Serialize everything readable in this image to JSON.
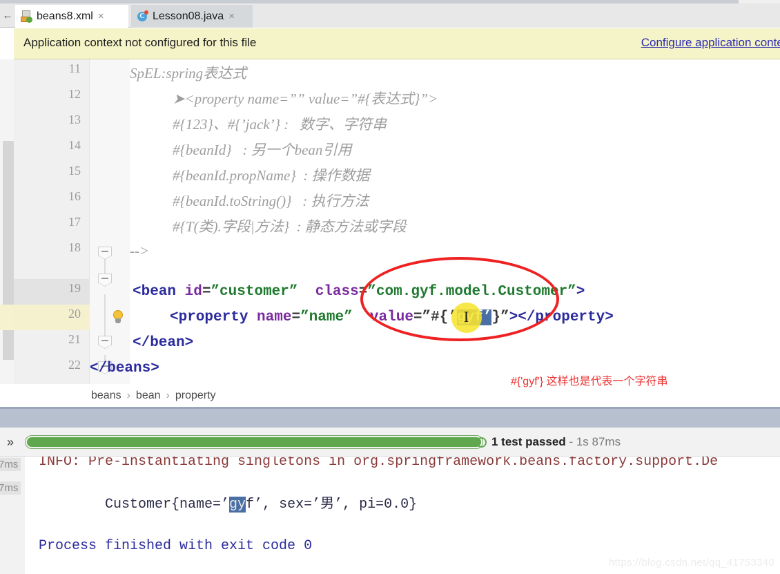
{
  "window": {
    "tabs": [
      {
        "label": "beans8.xml",
        "icon": "xml-file-icon",
        "active": true,
        "close": "×"
      },
      {
        "label": "Lesson08.java",
        "icon": "java-class-icon",
        "active": false,
        "close": "×"
      }
    ],
    "back_arrow": "←"
  },
  "banner": {
    "message": "Application context not configured for this file",
    "link": "Configure application context"
  },
  "editor": {
    "lines": [
      {
        "num": "11",
        "kind": "comment",
        "indent": 0,
        "text": "SpEL:spring表达式"
      },
      {
        "num": "12",
        "kind": "comment",
        "indent": 62,
        "text": "➤<property name=”” value=”#{表达式}”>"
      },
      {
        "num": "13",
        "kind": "comment",
        "indent": 62,
        "text": "#{123}、#{’jack’} :   数字、字符串"
      },
      {
        "num": "14",
        "kind": "comment",
        "indent": 62,
        "text": "#{beanId}   : 另一个bean引用"
      },
      {
        "num": "15",
        "kind": "comment",
        "indent": 62,
        "text": "#{beanId.propName}  : 操作数据"
      },
      {
        "num": "16",
        "kind": "comment",
        "indent": 62,
        "text": "#{beanId.toString()}   : 执行方法"
      },
      {
        "num": "17",
        "kind": "comment",
        "indent": 62,
        "text": "#{T(类).字段|方法}  : 静态方法或字段"
      },
      {
        "num": "18",
        "kind": "comment-end",
        "indent": 0,
        "text": "-->"
      },
      {
        "num": "19",
        "kind": "code-bean",
        "indent": 0
      },
      {
        "num": "20",
        "kind": "code-property",
        "indent": 0
      },
      {
        "num": "21",
        "kind": "code-bean-close",
        "indent": 0
      },
      {
        "num": "22",
        "kind": "code-beans-close",
        "indent": 0
      }
    ],
    "line19": {
      "open": "<bean ",
      "attr1": "id",
      "eq": "=",
      "val1": "”customer”",
      "space": "  ",
      "attr2": "class",
      "val2": "”com.gyf.model.Customer”",
      "close": ">"
    },
    "line20": {
      "open": "<property ",
      "attr1": "name",
      "val1": "”name”",
      "attr2": "value",
      "val_prefix": "”#{’",
      "val_selected": "gyf’",
      "val_suffix": "}”",
      "gt": ">",
      "close_tag": "</property>"
    },
    "line21": "</bean>",
    "line22": "</beans>",
    "caret_glyph": "I"
  },
  "annotation": {
    "text": "#{'gyf'} 这样也是代表一个字符串",
    "color": "#ee3333"
  },
  "breadcrumb": {
    "items": [
      "beans",
      "bean",
      "property"
    ],
    "separator": "›"
  },
  "run_panel": {
    "expand_icon": "»",
    "progress_percent": 100,
    "status_text": "1 test passed",
    "status_dash": " - ",
    "status_time": "1s 87ms",
    "gutter_times": [
      "7ms",
      "7ms"
    ],
    "console": [
      {
        "style": "info",
        "text": "INFO: Pre-instantiating singletons in org.springframework.beans.factory.support.De"
      },
      {
        "style": "output",
        "prefix": "Customer{name=’",
        "selected": "gy",
        "suffix": "f’, sex=’男’, pi=0.0}"
      },
      {
        "style": "blue",
        "text": "Process finished with exit code 0"
      }
    ]
  },
  "watermark": "https://blog.csdn.net/qq_41753340"
}
